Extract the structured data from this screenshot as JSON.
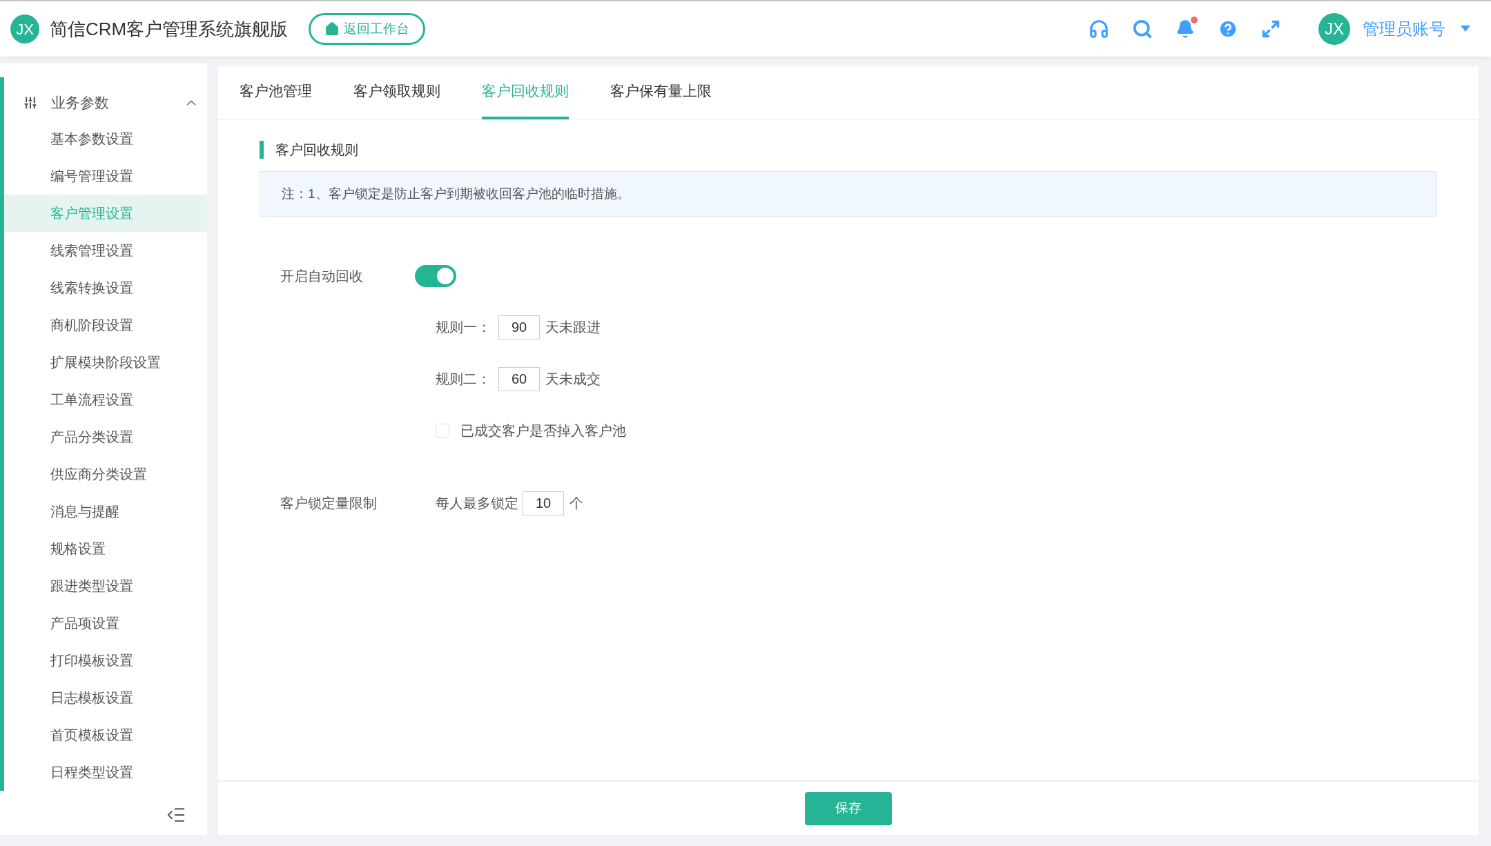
{
  "header": {
    "logo": "JX",
    "title": "简信CRM客户管理系统旗舰版",
    "home_button": "返回工作台",
    "notifications_unread": true,
    "avatar": "JX",
    "user": "管理员账号"
  },
  "sidebar": {
    "group": {
      "label": "业务参数",
      "expanded": true
    },
    "items": [
      {
        "label": "基本参数设置",
        "selected": false
      },
      {
        "label": "编号管理设置",
        "selected": false
      },
      {
        "label": "客户管理设置",
        "selected": true
      },
      {
        "label": "线索管理设置",
        "selected": false
      },
      {
        "label": "线索转换设置",
        "selected": false
      },
      {
        "label": "商机阶段设置",
        "selected": false
      },
      {
        "label": "扩展模块阶段设置",
        "selected": false
      },
      {
        "label": "工单流程设置",
        "selected": false
      },
      {
        "label": "产品分类设置",
        "selected": false
      },
      {
        "label": "供应商分类设置",
        "selected": false
      },
      {
        "label": "消息与提醒",
        "selected": false
      },
      {
        "label": "规格设置",
        "selected": false
      },
      {
        "label": "跟进类型设置",
        "selected": false
      },
      {
        "label": "产品项设置",
        "selected": false
      },
      {
        "label": "打印模板设置",
        "selected": false
      },
      {
        "label": "日志模板设置",
        "selected": false
      },
      {
        "label": "首页模板设置",
        "selected": false
      },
      {
        "label": "日程类型设置",
        "selected": false
      }
    ]
  },
  "tabs": [
    {
      "label": "客户池管理",
      "selected": false
    },
    {
      "label": "客户领取规则",
      "selected": false
    },
    {
      "label": "客户回收规则",
      "selected": true
    },
    {
      "label": "客户保有量上限",
      "selected": false
    }
  ],
  "section_title": "客户回收规则",
  "notice": "注：1、客户锁定是防止客户到期被收回客户池的临时措施。",
  "auto_recycle": {
    "label": "开启自动回收",
    "on": true
  },
  "rules": [
    {
      "label": "规则一：",
      "value": "90",
      "suffix": "天未跟进"
    },
    {
      "label": "规则二：",
      "value": "60",
      "suffix": "天未成交"
    }
  ],
  "deal_to_pool": {
    "label": "已成交客户是否掉入客户池",
    "checked": false
  },
  "lock_limit": {
    "label": "客户锁定量限制",
    "prefix": "每人最多锁定",
    "value": "10",
    "suffix": "个"
  },
  "save_button": "保存"
}
